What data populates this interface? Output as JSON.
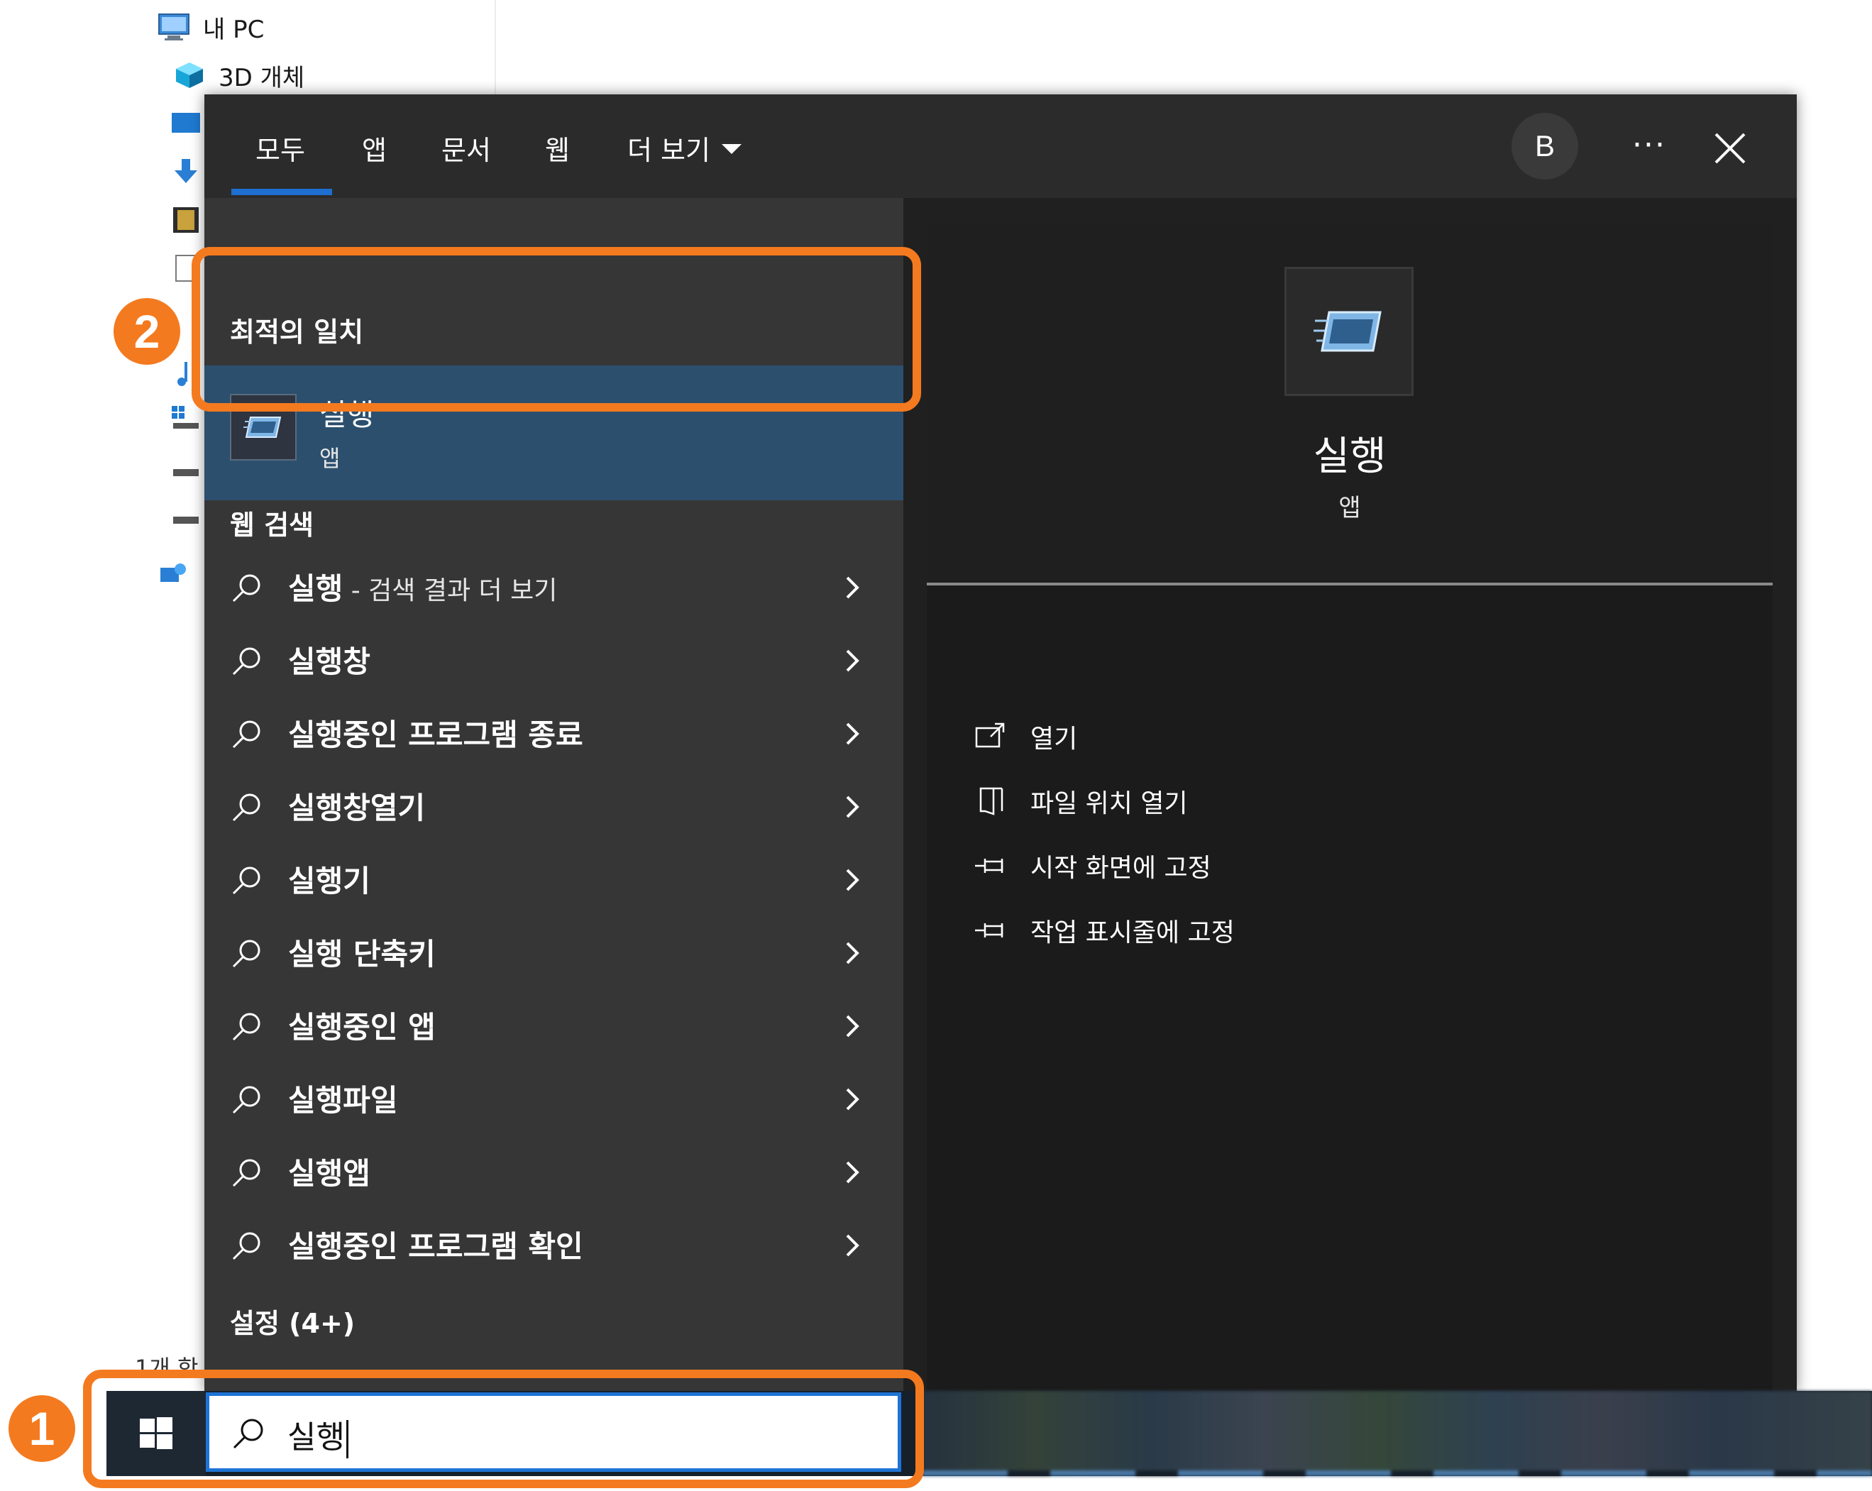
{
  "explorer": {
    "tree": [
      {
        "label": "내 PC",
        "icon": "monitor-icon"
      },
      {
        "label": "3D 개체",
        "icon": "cube-icon"
      }
    ],
    "status": "1개 항"
  },
  "search": {
    "tabs": [
      {
        "label": "모두",
        "active": true
      },
      {
        "label": "앱"
      },
      {
        "label": "문서"
      },
      {
        "label": "웹"
      },
      {
        "label": "더 보기"
      }
    ],
    "avatar_letter": "B",
    "more_label": "···",
    "best_match_heading": "최적의 일치",
    "best_match": {
      "title": "실행",
      "subtitle": "앱"
    },
    "web_heading": "웹 검색",
    "web_results": [
      {
        "label": "실행",
        "suffix": " - 검색 결과 더 보기"
      },
      {
        "label": "실행창",
        "suffix": ""
      },
      {
        "label": "실행중인 프로그램 종료",
        "suffix": ""
      },
      {
        "label": "실행창열기",
        "suffix": ""
      },
      {
        "label": "실행기",
        "suffix": ""
      },
      {
        "label": "실행 단축키",
        "suffix": ""
      },
      {
        "label": "실행중인 앱",
        "suffix": ""
      },
      {
        "label": "실행파일",
        "suffix": ""
      },
      {
        "label": "실행앱",
        "suffix": ""
      },
      {
        "label": "실행중인 프로그램 확인",
        "suffix": ""
      }
    ],
    "settings_heading": "설정 (4+)",
    "detail": {
      "title": "실행",
      "subtitle": "앱",
      "actions": [
        {
          "label": "열기",
          "icon": "open-icon"
        },
        {
          "label": "파일 위치 열기",
          "icon": "file-location-icon"
        },
        {
          "label": "시작 화면에 고정",
          "icon": "pin-icon"
        },
        {
          "label": "작업 표시줄에 고정",
          "icon": "pin-icon"
        }
      ]
    }
  },
  "taskbar": {
    "search_value": "실행"
  },
  "annotations": {
    "step1": "1",
    "step2": "2",
    "accent_color": "#f47a1f"
  },
  "colors": {
    "panel_bg": "#202020",
    "left_pane_bg": "#363636",
    "selected_bg": "#2c4f6e",
    "tab_underline": "#1e6fcf"
  }
}
